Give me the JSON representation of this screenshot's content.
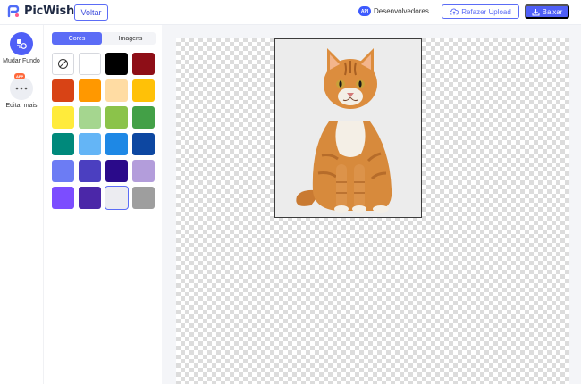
{
  "header": {
    "brand": "PicWish",
    "back_label": "Voltar",
    "api_badge": "API",
    "developers_label": "Desenvolvedores",
    "reupload_label": "Refazer Upload",
    "download_label": "Baixar",
    "accent_color": "#4f5ff7"
  },
  "rail": {
    "items": [
      {
        "label": "Mudar Fundo",
        "icon": "change-background-icon"
      },
      {
        "label": "Editar mais",
        "icon": "more-dots-icon",
        "badge": "APP"
      }
    ]
  },
  "panel": {
    "tabs": [
      {
        "label": "Cores",
        "active": true
      },
      {
        "label": "Imagens",
        "active": false
      }
    ],
    "swatches": [
      "none",
      "#ffffff",
      "#000000",
      "#8e0e17",
      "#d84315",
      "#ff9800",
      "#ffdca3",
      "#ffc107",
      "#ffeb3b",
      "#a5d68f",
      "#8bc34a",
      "#43a047",
      "#00897b",
      "#64b5f6",
      "#1e88e5",
      "#0d47a1",
      "#6c7cf4",
      "#4b3fc0",
      "#2a0a8a",
      "#b39ddb",
      "#7c4dff",
      "#4b27a8",
      "#ececf1",
      "#9e9e9e"
    ],
    "selected_swatch": 22
  },
  "canvas": {
    "photo_background": "#ececec",
    "subject": "cat-image"
  }
}
